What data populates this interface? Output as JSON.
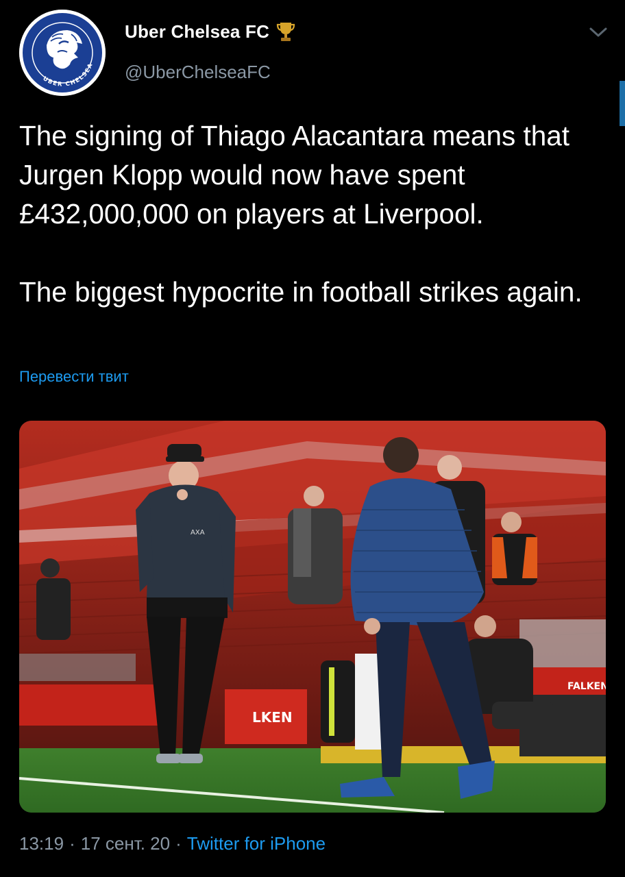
{
  "tweet": {
    "display_name": "Uber Chelsea FC",
    "handle": "@UberChelseaFC",
    "avatar_text": "UBER CHELSEA FC",
    "text_paragraphs": [
      "The signing of Thiago Alacantara means that Jurgen Klopp would now have spent £432,000,000 on players at Liverpool.",
      "The biggest hypocrite in football strikes again."
    ],
    "translate_label": "Перевести твит",
    "time": "13:19",
    "date": "17 сент. 20",
    "separator": "·",
    "source": "Twitter for iPhone",
    "badge_icon": "trophy-icon",
    "menu_icon": "chevron-down-icon"
  },
  "media": {
    "board_text_1": "FALKEN",
    "board_text_2": "LKEN",
    "board_text_3": "AXA"
  },
  "colors": {
    "background": "#000000",
    "text": "#ffffff",
    "muted": "#8b98a5",
    "link": "#1d9bf0",
    "avatar_blue": "#1b3f94"
  }
}
